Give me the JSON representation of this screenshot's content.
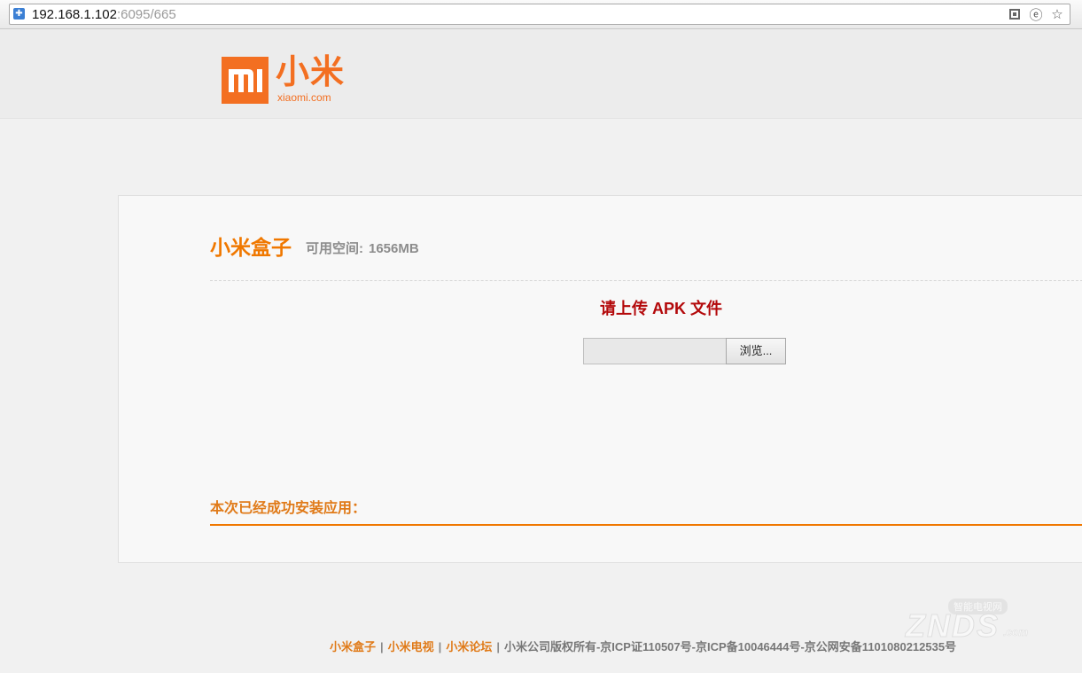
{
  "browser": {
    "url_host": "192.168.1.102",
    "url_path": ":6095/665",
    "icons": [
      "shield-icon",
      "qr-code-icon",
      "ie-compat-icon",
      "bookmark-star-icon"
    ]
  },
  "header": {
    "logo_mark_text": "mi",
    "logo_wordmark": "小米",
    "logo_domain": "xiaomi.com"
  },
  "main": {
    "title": "小米盒子",
    "space_label": "可用空间:",
    "space_value": "1656MB",
    "upload_prompt": "请上传 APK 文件",
    "file_input_value": "",
    "browse_label": "浏览...",
    "installed_title": "本次已经成功安装应用："
  },
  "footer": {
    "links": [
      "小米盒子",
      "小米电视",
      "小米论坛"
    ],
    "separator": "|",
    "copyright": "小米公司版权所有-京ICP证110507号-京ICP备10046444号-京公网安备1101080212535号"
  },
  "watermark": {
    "badge": "智能电视网",
    "brand": "ZNDS",
    "suffix": ".com"
  },
  "colors": {
    "brand_orange": "#f36f21",
    "title_orange": "#f07800",
    "prompt_red": "#b3080a"
  }
}
